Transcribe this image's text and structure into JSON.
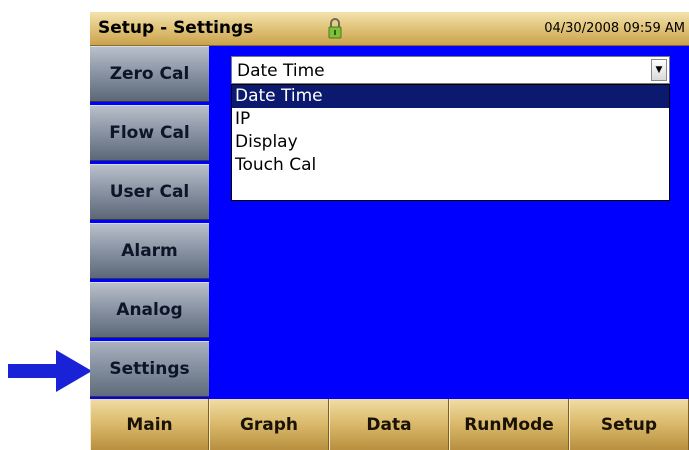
{
  "titlebar": {
    "title": "Setup - Settings",
    "lock_icon": "padlock-icon",
    "datetime": "04/30/2008 09:59 AM"
  },
  "sidebar": {
    "items": [
      {
        "label": "Zero Cal"
      },
      {
        "label": "Flow Cal"
      },
      {
        "label": "User Cal"
      },
      {
        "label": "Alarm"
      },
      {
        "label": "Analog"
      },
      {
        "label": "Settings",
        "active": true
      }
    ]
  },
  "dropdown": {
    "value": "Date Time",
    "arrow_icon": "dropdown-arrow-icon",
    "options": [
      {
        "label": "Date Time",
        "selected": true
      },
      {
        "label": "IP"
      },
      {
        "label": "Display"
      },
      {
        "label": "Touch Cal"
      }
    ]
  },
  "bottombar": {
    "items": [
      {
        "label": "Main"
      },
      {
        "label": "Graph"
      },
      {
        "label": "Data"
      },
      {
        "label": "RunMode"
      },
      {
        "label": "Setup"
      }
    ]
  },
  "callout": {
    "icon": "pointer-arrow-icon",
    "color": "#1a22d8"
  },
  "colors": {
    "screen_bg": "#0000ff",
    "selected_option": "#0b1a6e"
  }
}
